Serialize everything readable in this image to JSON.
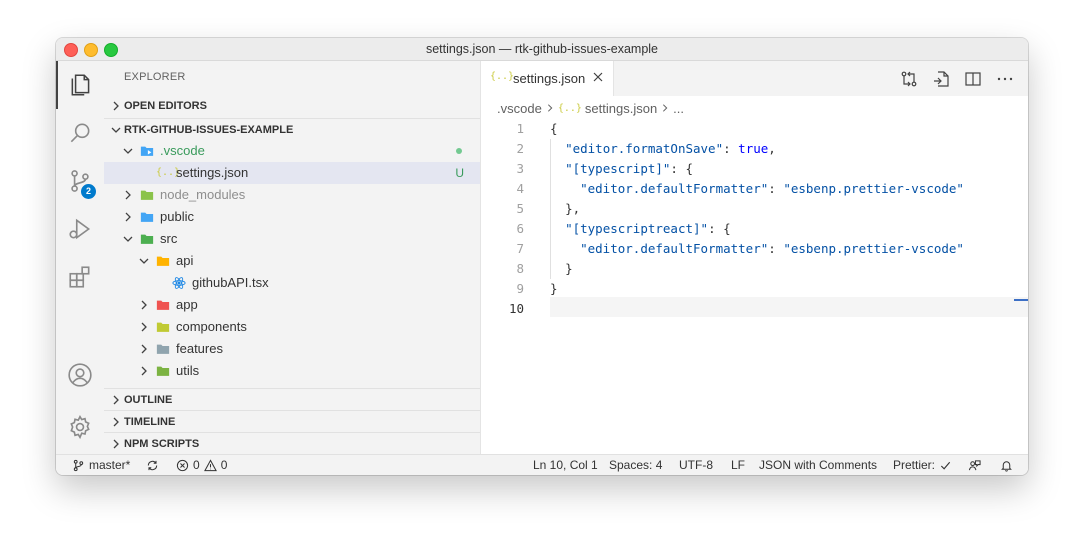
{
  "window": {
    "title": "settings.json — rtk-github-issues-example"
  },
  "activity": {
    "scm_badge": "2"
  },
  "sidebar": {
    "title": "EXPLORER",
    "open_editors": "OPEN EDITORS",
    "project": "RTK-GITHUB-ISSUES-EXAMPLE",
    "tree": [
      {
        "label": ".vscode",
        "decoration": ""
      },
      {
        "label": "settings.json",
        "decoration": "U"
      },
      {
        "label": "node_modules"
      },
      {
        "label": "public"
      },
      {
        "label": "src"
      },
      {
        "label": "api"
      },
      {
        "label": "githubAPI.tsx"
      },
      {
        "label": "app"
      },
      {
        "label": "components"
      },
      {
        "label": "features"
      },
      {
        "label": "utils"
      }
    ],
    "outline": "OUTLINE",
    "timeline": "TIMELINE",
    "npm_scripts": "NPM SCRIPTS"
  },
  "editor": {
    "tab_label": "settings.json",
    "breadcrumb": [
      ".vscode",
      "settings.json",
      "..."
    ],
    "line_numbers": [
      "1",
      "2",
      "3",
      "4",
      "5",
      "6",
      "7",
      "8",
      "9",
      "10"
    ],
    "code": {
      "l1": "{",
      "l2_key": "\"editor.formatOnSave\"",
      "l2_val": "true",
      "l3_key": "\"[typescript]\"",
      "l4_key": "\"editor.defaultFormatter\"",
      "l4_val": "\"esbenp.prettier-vscode\"",
      "l5": "},",
      "l6_key": "\"[typescriptreact]\"",
      "l7_key": "\"editor.defaultFormatter\"",
      "l7_val": "\"esbenp.prettier-vscode\"",
      "l8": "}",
      "l9": "}"
    }
  },
  "status": {
    "branch": "master*",
    "errors": "0",
    "warnings": "0",
    "position": "Ln 10, Col 1",
    "spaces": "Spaces: 4",
    "encoding": "UTF-8",
    "eol": "LF",
    "language": "JSON with Comments",
    "prettier": "Prettier:"
  },
  "colors": {
    "accent": "#007acc",
    "modified_green": "#73c991",
    "folder_blue": "#42a5f5",
    "folder_green": "#4caf50"
  }
}
